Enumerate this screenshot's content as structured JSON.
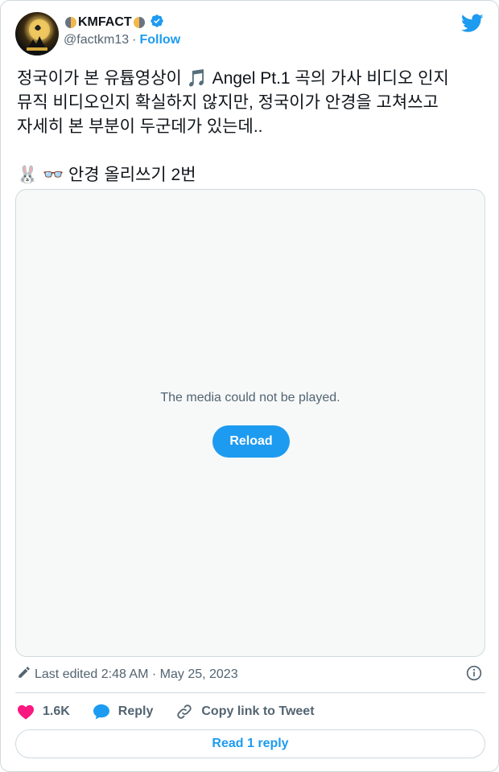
{
  "author": {
    "display_name": "KMFACT",
    "handle": "@factkm13",
    "separator": "·",
    "follow_label": "Follow"
  },
  "tweet": {
    "text": "정국이가 본 유튭영상이 🎵 Angel Pt.1 곡의 가사 비디오 인지 뮤직 비디오인지 확실하지 않지만, 정국이가 안경을 고쳐쓰고 자세히 본 부분이 두군데가 있는데..\n\n🐰 👓 안경 올리쓰기 2번"
  },
  "media": {
    "error_message": "The media could not be played.",
    "reload_label": "Reload"
  },
  "meta": {
    "edited_text": "Last edited 2:48 AM · May 25, 2023"
  },
  "actions": {
    "like_count": "1.6K",
    "reply_label": "Reply",
    "copy_link_label": "Copy link to Tweet"
  },
  "read_reply_label": "Read 1 reply",
  "colors": {
    "brand_blue": "#1d9bf0",
    "like_pink": "#f91880",
    "muted_text": "#536471",
    "border": "#cfd9de"
  }
}
